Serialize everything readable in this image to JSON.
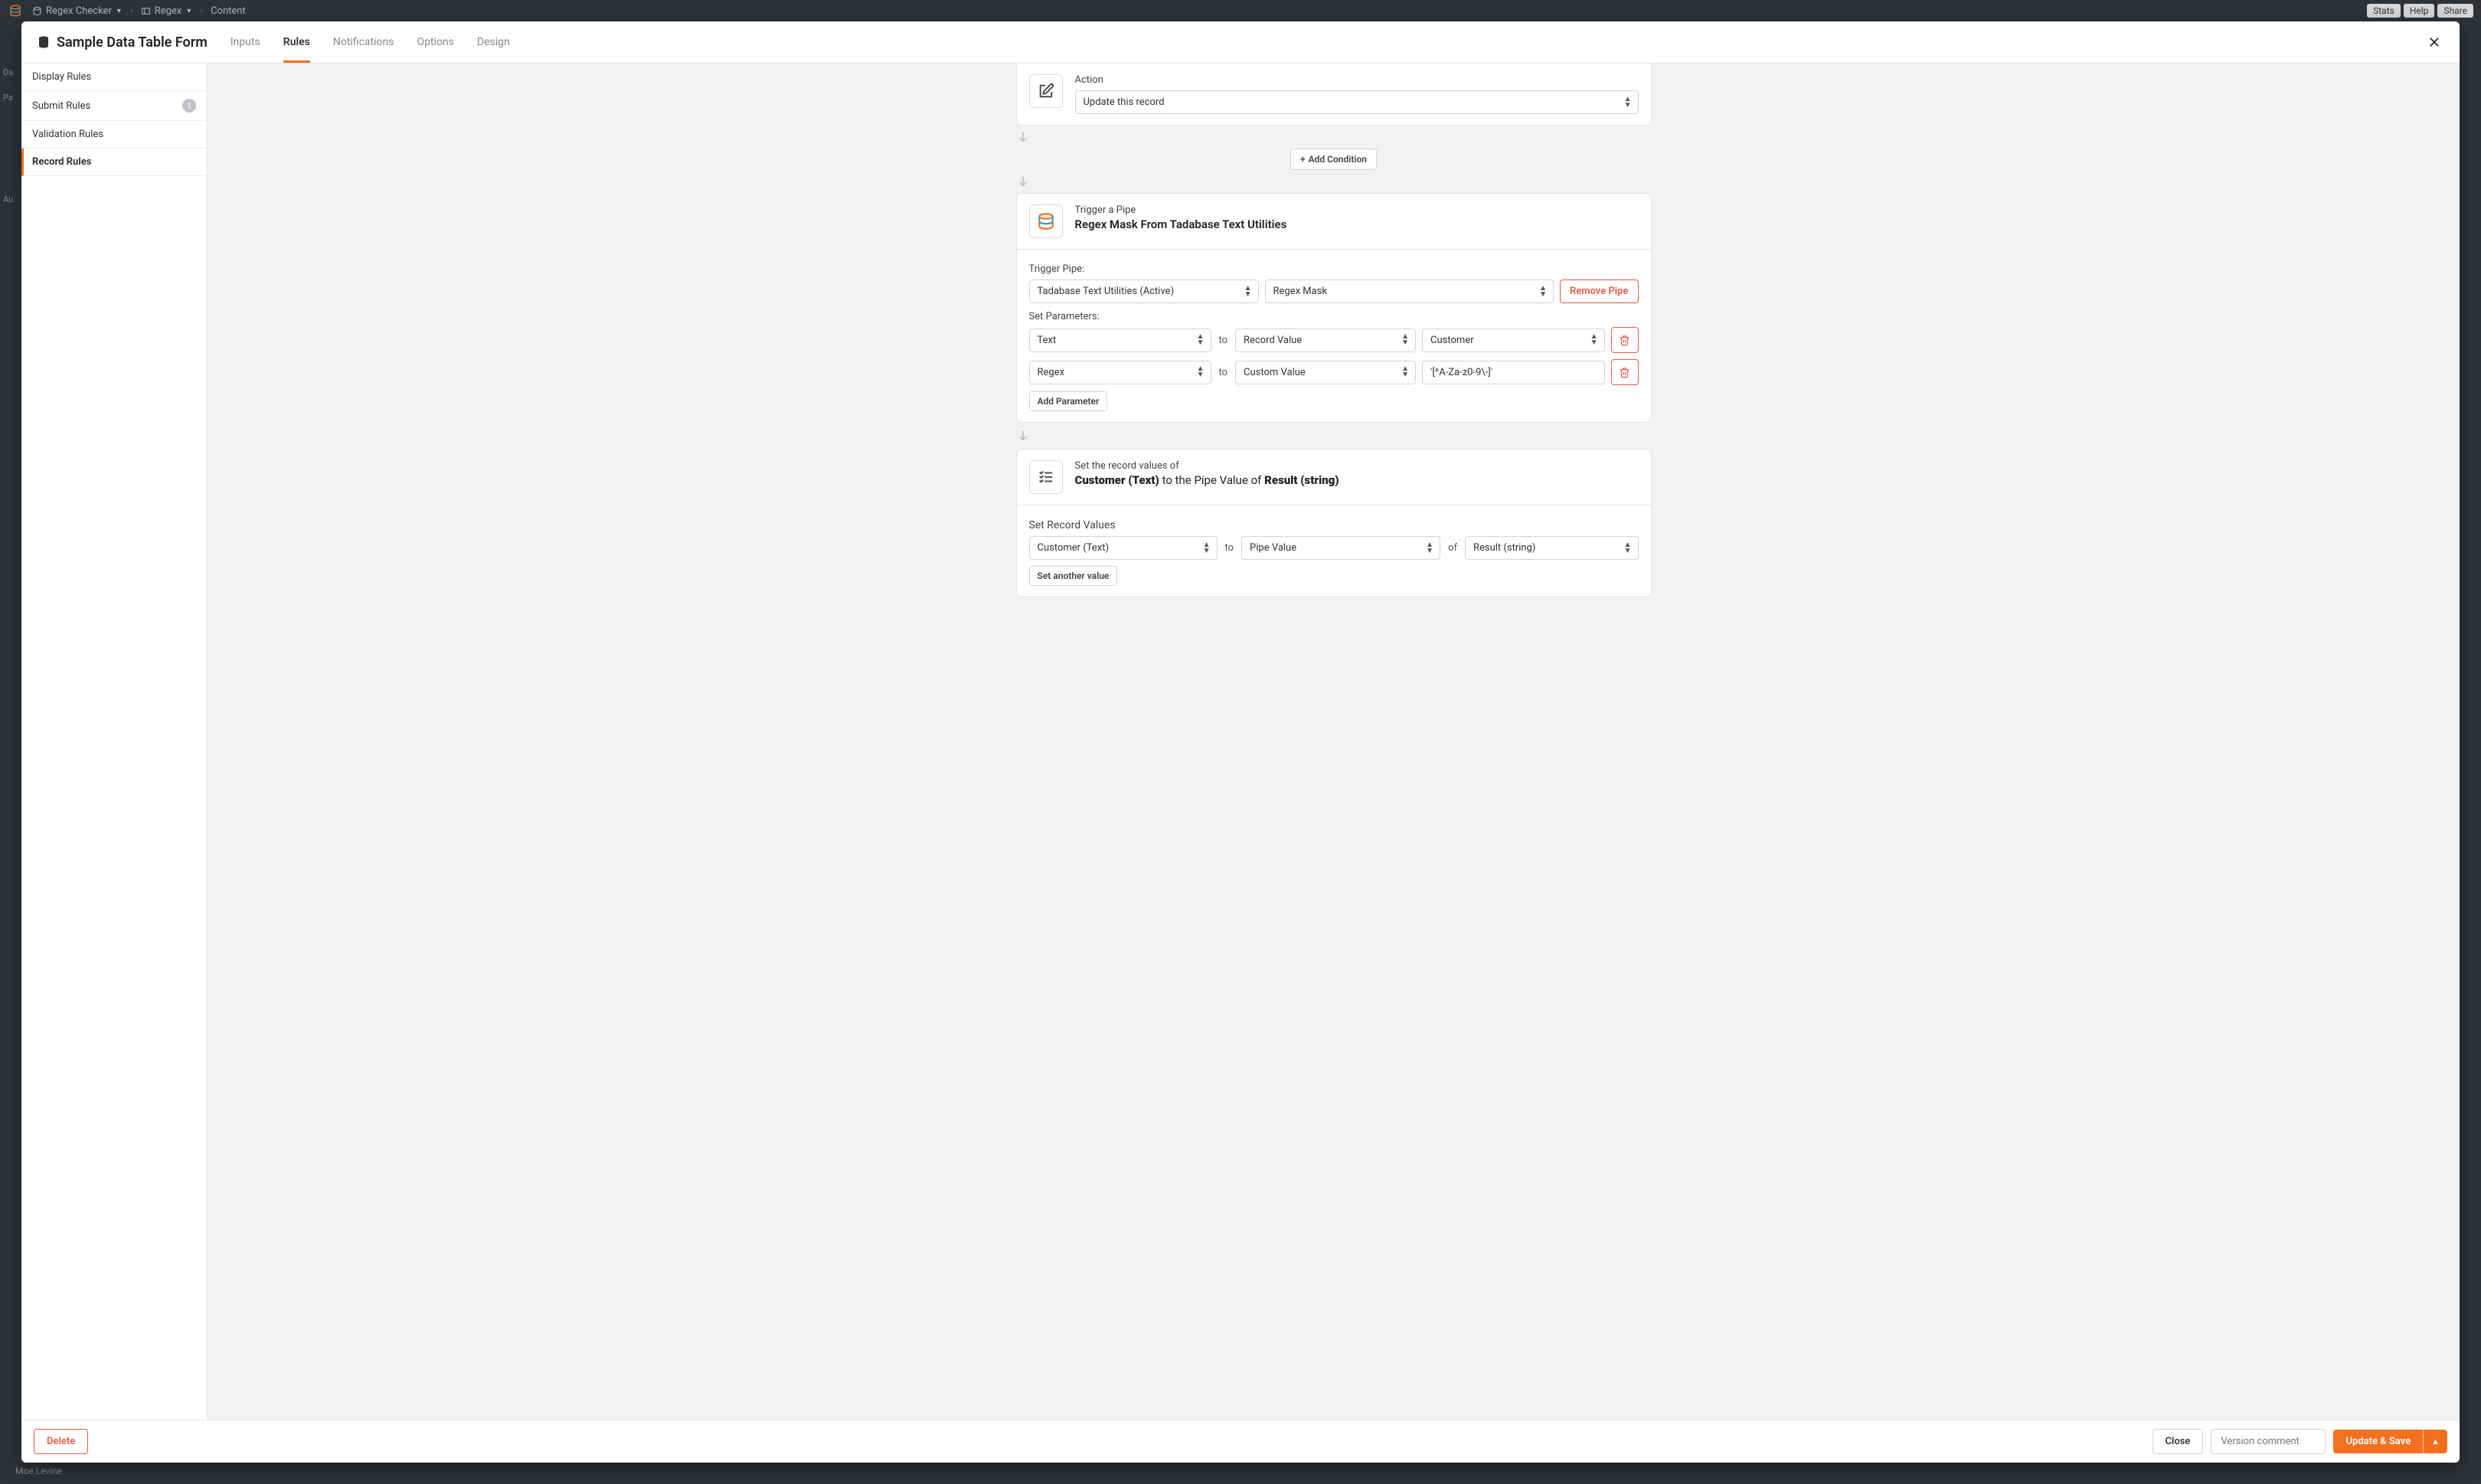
{
  "topbar": {
    "breadcrumbs": [
      "Regex Checker",
      "Regex",
      "Content"
    ],
    "buttons": [
      "Stats",
      "Help",
      "Share"
    ]
  },
  "background": {
    "left_items": [
      "Da",
      "Pa",
      "Au"
    ],
    "bottom_text": "Moe Levine"
  },
  "modal": {
    "title": "Sample Data Table Form",
    "tabs": [
      "Inputs",
      "Rules",
      "Notifications",
      "Options",
      "Design"
    ],
    "active_tab": 1,
    "sidebar": {
      "items": [
        {
          "label": "Display Rules",
          "count": null,
          "active": false
        },
        {
          "label": "Submit Rules",
          "count": "1",
          "active": false
        },
        {
          "label": "Validation Rules",
          "count": null,
          "active": false
        },
        {
          "label": "Record Rules",
          "count": null,
          "active": true
        }
      ]
    },
    "action_card": {
      "small": "Action",
      "select_value": "Update this record"
    },
    "add_condition": "Add Condition",
    "pipe_card": {
      "small": "Trigger a Pipe",
      "big": "Regex Mask From Tadabase Text Utilities",
      "trigger_pipe_label": "Trigger Pipe:",
      "pipe_select": "Tadabase Text Utilities (Active)",
      "method_select": "Regex Mask",
      "remove_pipe": "Remove Pipe",
      "params_label": "Set Parameters:",
      "params": [
        {
          "p": "Text",
          "type": "Record Value",
          "val": "Customer",
          "val_is_select": true
        },
        {
          "p": "Regex",
          "type": "Custom Value",
          "val": "'[^A-Za-z0-9\\-]'",
          "val_is_select": false
        }
      ],
      "to_label": "to",
      "add_param": "Add Parameter"
    },
    "values_card": {
      "small": "Set the record values of",
      "big_field": "Customer (Text)",
      "big_mid": " to the Pipe Value of ",
      "big_result": "Result (string)",
      "section_label": "Set Record Values",
      "row": {
        "field": "Customer (Text)",
        "to": "to",
        "source": "Pipe Value",
        "of": "of",
        "result": "Result (string)"
      },
      "set_another": "Set another value"
    },
    "footer": {
      "delete": "Delete",
      "close": "Close",
      "version_placeholder": "Version comment",
      "save": "Update & Save"
    }
  }
}
